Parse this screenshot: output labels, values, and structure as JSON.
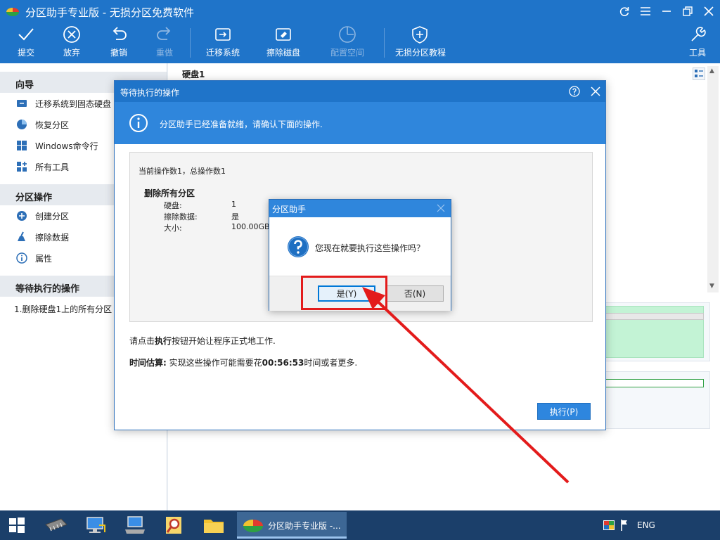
{
  "window": {
    "title": "分区助手专业版 - 无损分区免费软件"
  },
  "toolbar": {
    "commit": "提交",
    "discard": "放弃",
    "undo": "撤销",
    "redo": "重做",
    "migrate_os": "迁移系统",
    "wipe_disk": "擦除磁盘",
    "allocate_space": "配置空间",
    "tutorial": "无损分区教程",
    "tools": "工具"
  },
  "sidebar": {
    "wizard": {
      "title": "向导",
      "items": [
        "迁移系统到固态硬盘",
        "恢复分区",
        "Windows命令行",
        "所有工具"
      ]
    },
    "partition_ops": {
      "title": "分区操作",
      "items": [
        "创建分区",
        "擦除数据",
        "属性"
      ]
    },
    "pending": {
      "title": "等待执行的操作",
      "items": [
        "1.删除硬盘1上的所有分区"
      ]
    }
  },
  "content": {
    "disk_label": "硬盘1"
  },
  "ops_dialog": {
    "title": "等待执行的操作",
    "banner": "分区助手已经准备就绪，请确认下面的操作.",
    "current_ops": "当前操作数1，总操作数1",
    "op_title": "删除所有分区",
    "rows": [
      {
        "key": "硬盘:",
        "value": "1"
      },
      {
        "key": "擦除数据:",
        "value": "是"
      },
      {
        "key": "大小:",
        "value": "100.00GB"
      }
    ],
    "note_pre": "请点击",
    "note_bold": "执行",
    "note_post": "按钮开始让程序正式地工作.",
    "time_label": "时间估算:",
    "time_pre": " 实现这些操作可能需要花",
    "time_value": "00:56:53",
    "time_post": "时间或者更多.",
    "execute": "执行(P)"
  },
  "confirm_dialog": {
    "title": "分区助手",
    "message": "您现在就要执行这些操作吗？",
    "yes": "是(Y)",
    "no": "否(N)"
  },
  "taskbar": {
    "active_app": "分区助手专业版 -...",
    "lang": "ENG"
  },
  "colors": {
    "accent": "#1f74c9",
    "highlight": "#e31b1b",
    "disk_fill": "#c3f3d5"
  }
}
